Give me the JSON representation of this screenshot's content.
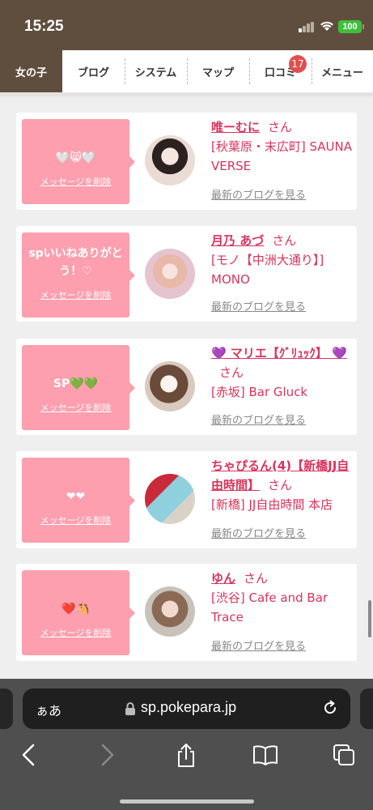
{
  "status": {
    "time": "15:25",
    "battery": "100"
  },
  "nav": {
    "tabs": [
      {
        "label": "女の子",
        "active": true
      },
      {
        "label": "ブログ"
      },
      {
        "label": "システム"
      },
      {
        "label": "マップ"
      },
      {
        "label": "口コミ",
        "badge": "17"
      },
      {
        "label": "メニュー"
      }
    ]
  },
  "messages": [
    {
      "msg": "🤍😸🤍",
      "delete": "メッセージを削除",
      "name": "唯ーむに",
      "san": "さん",
      "shop": "[秋葉原・末広町] SAUNA VERSE",
      "blog": "最新のブログを見る"
    },
    {
      "msg": "spいいねありがとう！♡",
      "delete": "メッセージを削除",
      "name": "月乃 あづ",
      "san": "さん",
      "shop": "[モノ【中洲大通り】] MONO",
      "blog": "最新のブログを見る"
    },
    {
      "msg": "SP💚💚",
      "delete": "メッセージを削除",
      "name": "💜 マリエ【ｸﾞﾘｭｯｸ】 💜",
      "san": "さん",
      "shop": "[赤坂] Bar Gluck",
      "blog": "最新のブログを見る"
    },
    {
      "msg": "❤❤",
      "delete": "メッセージを削除",
      "name": "ちゃぴるん(4)【新橋JJ自由時間】",
      "san": "さん",
      "shop": "[新橋] JJ自由時間 本店",
      "blog": "最新のブログを見る"
    },
    {
      "msg": "❤️🐴",
      "delete": "メッセージを削除",
      "name": "ゆん",
      "san": "さん",
      "shop": "[渋谷] Cafe and Bar Trace",
      "blog": "最新のブログを見る"
    }
  ],
  "browser": {
    "aa": "ぁあ",
    "url": "sp.pokepara.jp"
  },
  "icons": {
    "back": "chevron-left-icon",
    "forward": "chevron-right-icon",
    "share": "share-icon",
    "bookmarks": "book-icon",
    "tabs": "tabs-icon"
  }
}
